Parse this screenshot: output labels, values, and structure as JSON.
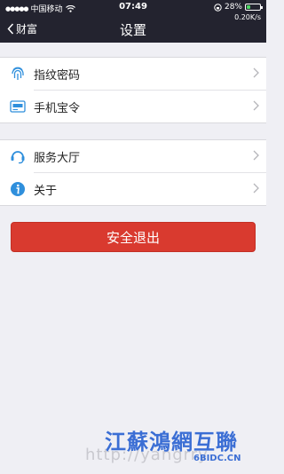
{
  "status_bar": {
    "carrier": "中国移动",
    "time": "07:49",
    "battery": "28%",
    "battery_level": 0.28,
    "speed": "0.20K/s"
  },
  "nav": {
    "back_label": "财富",
    "title": "设置"
  },
  "groups": [
    {
      "items": [
        {
          "label": "指纹密码",
          "icon": "fingerprint-icon"
        },
        {
          "label": "手机宝令",
          "icon": "token-card-icon"
        }
      ]
    },
    {
      "items": [
        {
          "label": "服务大厅",
          "icon": "headset-icon"
        },
        {
          "label": "关于",
          "icon": "info-icon"
        }
      ]
    }
  ],
  "logout_label": "安全退出",
  "colors": {
    "accent_blue": "#2f8fdc",
    "logout_red": "#d93a2f",
    "navbar": "#23232f"
  },
  "watermark": {
    "brand": "江蘇鴻網互聯",
    "url": "http://yangrry",
    "domain": "6BIDC.CN"
  }
}
